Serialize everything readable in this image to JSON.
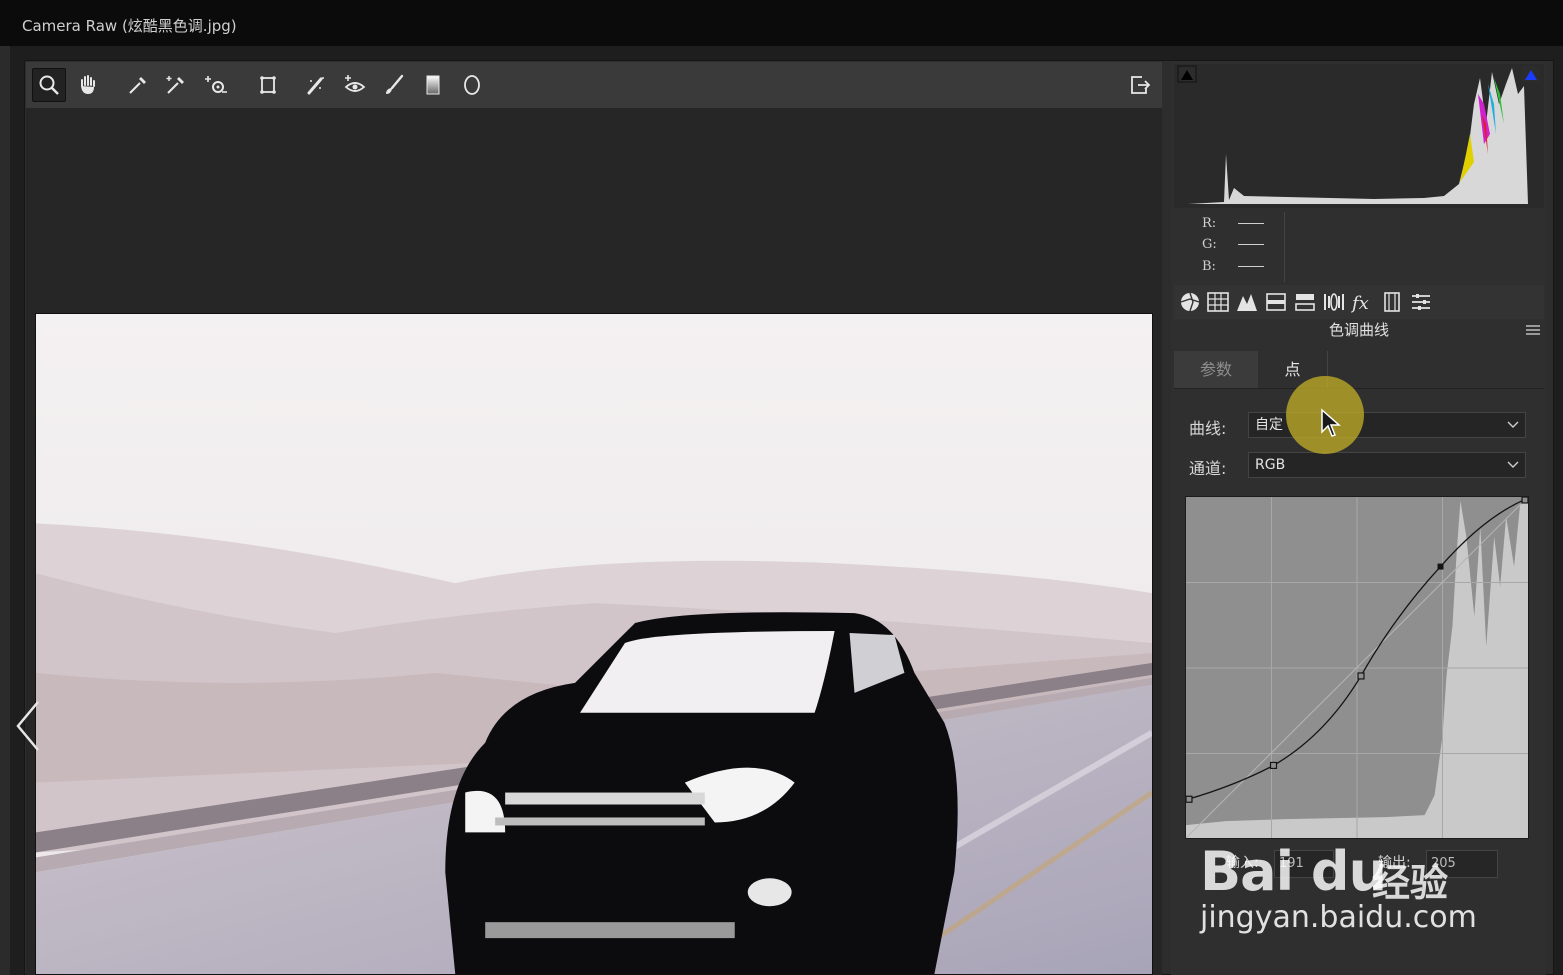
{
  "window": {
    "title": "Camera Raw (炫酷黑色调.jpg)"
  },
  "toolbar": {
    "tools": [
      {
        "name": "zoom-tool",
        "active": true
      },
      {
        "name": "hand-tool"
      },
      {
        "name": "white-balance-tool"
      },
      {
        "name": "color-sampler-tool"
      },
      {
        "name": "targeted-adjustment-tool"
      },
      {
        "name": "crop-tool"
      },
      {
        "name": "spot-removal-tool"
      },
      {
        "name": "red-eye-tool"
      },
      {
        "name": "adjustment-brush-tool"
      },
      {
        "name": "graduated-filter-tool"
      },
      {
        "name": "radial-filter-tool"
      }
    ],
    "export_icon": "open-export-icon"
  },
  "readout": {
    "r_label": "R:",
    "g_label": "G:",
    "b_label": "B:"
  },
  "panel": {
    "title": "色调曲线",
    "tabs": [
      {
        "label": "参数",
        "selected": false
      },
      {
        "label": "点",
        "selected": true
      }
    ],
    "curve_label": "曲线:",
    "curve_value": "自定",
    "channel_label": "通道:",
    "channel_value": "RGB",
    "input_label": "输入:",
    "input_value": "191",
    "output_label": "输出:",
    "output_value": "205"
  },
  "watermark": {
    "logo": "Bai du",
    "cn": "经验",
    "url": "jingyan.baidu.com"
  },
  "colors": {
    "accent_highlight": "#bea828",
    "panel_bg": "#2f2f2f",
    "curve_bg": "#8f8f8f"
  }
}
